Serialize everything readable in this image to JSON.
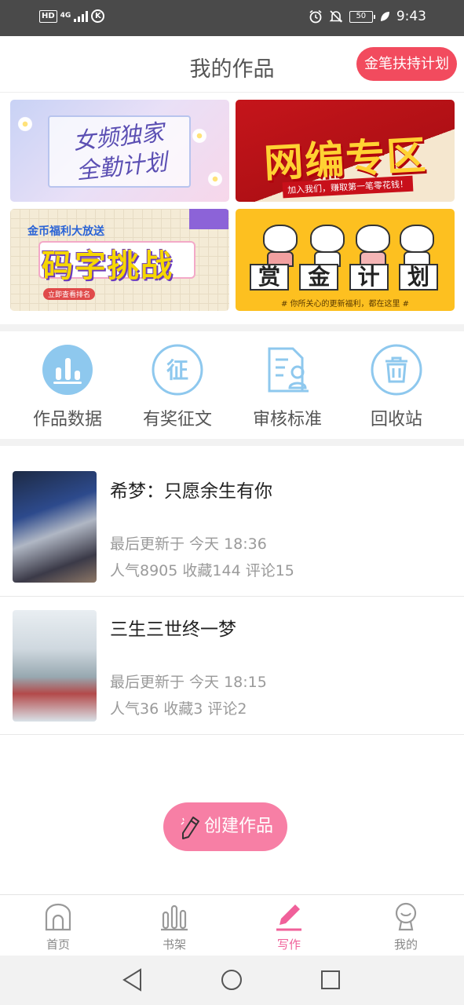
{
  "status_bar": {
    "hd": "HD",
    "network": "4G",
    "carrier_badge": "K",
    "battery": "50",
    "time": "9:43"
  },
  "header": {
    "title": "我的作品",
    "plan_button": "金笔扶持计划"
  },
  "banners": [
    {
      "name": "女频独家全勤计划",
      "line1": "女频独家",
      "line2": "全勤计划"
    },
    {
      "name": "网编专区",
      "text": "网编专区",
      "sub": "加入我们，赚取第一笔零花钱！"
    },
    {
      "name": "码字挑战",
      "top": "金币福利大放送",
      "text": "码字挑战",
      "tag": "立即查看排名"
    },
    {
      "name": "赏金计划",
      "chars": [
        "赏",
        "金",
        "计",
        "划"
      ],
      "sub": "# 你所关心的更新福利，都在这里 #"
    }
  ],
  "quick_actions": [
    {
      "label": "作品数据",
      "icon": "bar-chart-icon"
    },
    {
      "label": "有奖征文",
      "icon": "contest-icon"
    },
    {
      "label": "审核标准",
      "icon": "review-doc-icon"
    },
    {
      "label": "回收站",
      "icon": "trash-icon"
    }
  ],
  "works": [
    {
      "title": "希梦：只愿余生有你",
      "updated": "最后更新于 今天 18:36",
      "stats": "人气8905  收藏144  评论15"
    },
    {
      "title": "三生三世终一梦",
      "updated": "最后更新于 今天 18:15",
      "stats": "人气36  收藏3  评论2"
    }
  ],
  "create_button": "创建作品",
  "tabs": [
    {
      "label": "首页",
      "icon": "home-icon"
    },
    {
      "label": "书架",
      "icon": "bookshelf-icon"
    },
    {
      "label": "写作",
      "icon": "pencil-icon",
      "active": true
    },
    {
      "label": "我的",
      "icon": "profile-icon"
    }
  ],
  "colors": {
    "accent": "#f24b5e",
    "pink": "#f77fa5",
    "active_tab": "#f0609a",
    "icon_blue": "#8ec8ee"
  }
}
